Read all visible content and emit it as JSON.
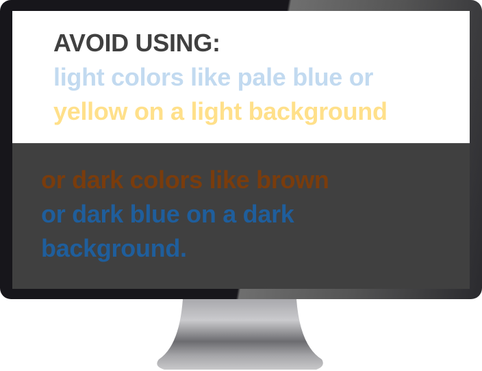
{
  "light_section": {
    "heading": "AVOID USING:",
    "line1": "light colors like pale blue or",
    "line2": "yellow on a light background"
  },
  "dark_section": {
    "line1": "or dark colors like brown",
    "line2": "or dark blue on a dark",
    "line3": "background."
  },
  "colors": {
    "heading": "#404040",
    "pale_blue": "#c2daf0",
    "yellow": "#ffe08a",
    "brown": "#7a3c0c",
    "dark_blue": "#1f5e9c",
    "dark_background": "#404040"
  }
}
